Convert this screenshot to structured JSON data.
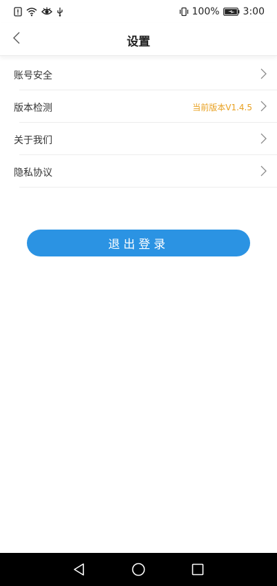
{
  "status_bar": {
    "battery_percent": "100%",
    "time": "3:00",
    "icons": [
      "alert-icon",
      "wifi-icon",
      "eye-icon",
      "usb-icon",
      "vibrate-icon",
      "battery-icon"
    ]
  },
  "header": {
    "title": "设置",
    "back_icon": "chevron-left-icon"
  },
  "settings": {
    "items": [
      {
        "label": "账号安全",
        "value": ""
      },
      {
        "label": "版本检测",
        "value": "当前版本V1.4.5"
      },
      {
        "label": "关于我们",
        "value": ""
      },
      {
        "label": "隐私协议",
        "value": ""
      }
    ]
  },
  "logout": {
    "label": "退出登录"
  },
  "nav_bar": {
    "icons": [
      "back-triangle-icon",
      "home-circle-icon",
      "recents-square-icon"
    ]
  },
  "colors": {
    "accent": "#2b93e3",
    "version_text": "#e8a020",
    "nav_background": "#000000"
  }
}
